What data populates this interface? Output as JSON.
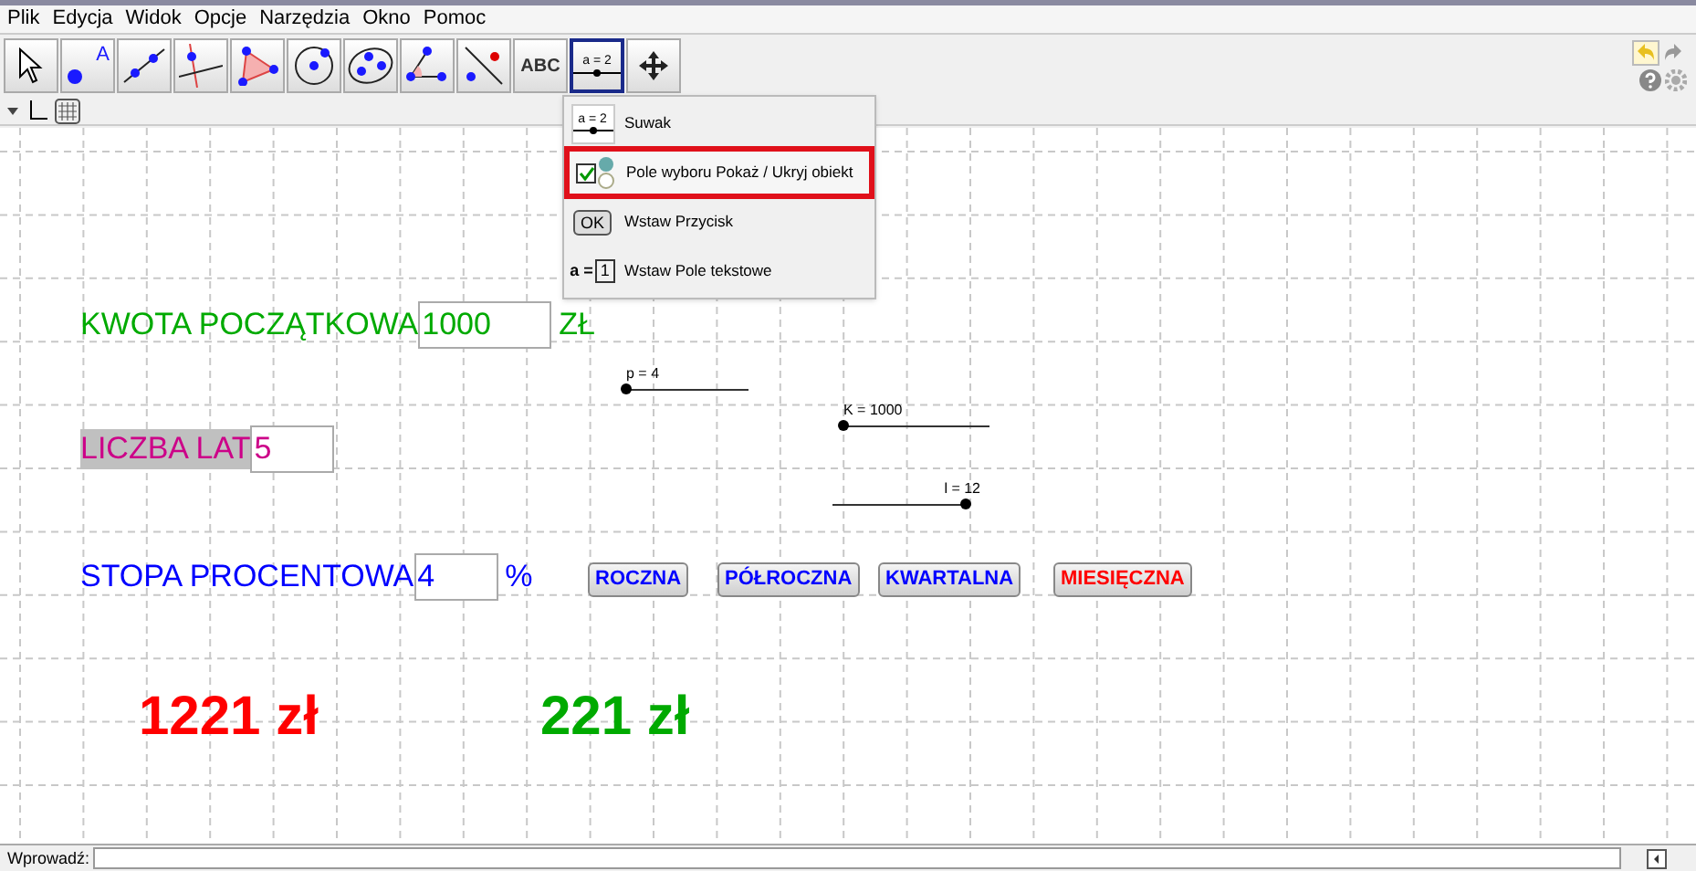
{
  "menu": [
    "Plik",
    "Edycja",
    "Widok",
    "Opcje",
    "Narzędzia",
    "Okno",
    "Pomoc"
  ],
  "toolbar": [
    {
      "kind": "move",
      "selected": false
    },
    {
      "kind": "point",
      "selected": false,
      "label": "A"
    },
    {
      "kind": "line",
      "selected": false
    },
    {
      "kind": "perp",
      "selected": false
    },
    {
      "kind": "polygon",
      "selected": false
    },
    {
      "kind": "circle",
      "selected": false
    },
    {
      "kind": "conic",
      "selected": false
    },
    {
      "kind": "angle",
      "selected": false
    },
    {
      "kind": "reflect",
      "selected": false
    },
    {
      "kind": "text",
      "selected": false,
      "label": "ABC"
    },
    {
      "kind": "slider",
      "selected": true,
      "label": "a = 2"
    },
    {
      "kind": "pan",
      "selected": false
    }
  ],
  "dropdown": [
    {
      "kind": "slider",
      "icon_label": "a = 2",
      "label": "Suwak",
      "selected": false
    },
    {
      "kind": "checkbox",
      "label": "Pole wyboru Pokaż / Ukryj obiekt",
      "selected": true
    },
    {
      "kind": "button",
      "icon_label": "OK",
      "label": "Wstaw Przycisk",
      "selected": false
    },
    {
      "kind": "textfield",
      "icon_label": "a =",
      "icon_value": "1",
      "label": "Wstaw Pole tekstowe",
      "selected": false
    }
  ],
  "canvas": {
    "fields": [
      {
        "label": "KWOTA POCZĄTKOWA",
        "value": "1000",
        "unit": "ZŁ",
        "color": "#00aa00",
        "highlighted": false
      },
      {
        "label": "LICZBA LAT",
        "value": "5",
        "color": "#cc0088",
        "highlighted": true
      },
      {
        "label": "STOPA PROCENTOWA",
        "value": "4",
        "unit": "%",
        "color": "#0000ff",
        "highlighted": false
      }
    ],
    "sliders": [
      {
        "caption": "p = 4",
        "level": 0
      },
      {
        "caption": "K = 1000",
        "level": 0
      },
      {
        "caption": "l = 12",
        "level": 1
      }
    ],
    "buttons": [
      {
        "label": "ROCZNA",
        "color": "#0000ff"
      },
      {
        "label": "PÓŁROCZNA",
        "color": "#0000ff"
      },
      {
        "label": "KWARTALNA",
        "color": "#0000ff"
      },
      {
        "label": "MIESIĘCZNA",
        "color": "#ff0000"
      }
    ],
    "results": [
      {
        "text": "1221 zł",
        "color": "#ff0000"
      },
      {
        "text": "221 zł",
        "color": "#00aa00"
      }
    ]
  },
  "input_bar": {
    "label": "Wprowadź:"
  }
}
